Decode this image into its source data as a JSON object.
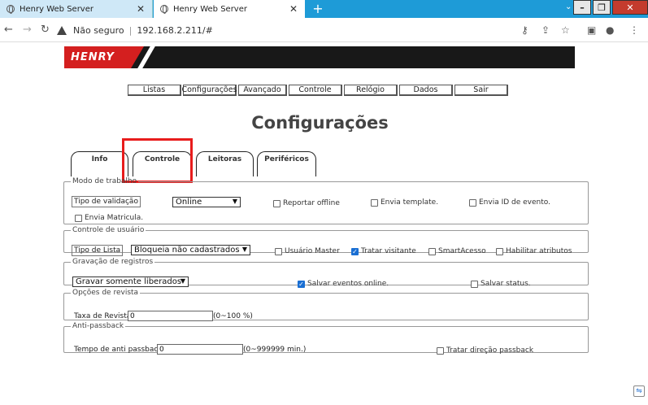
{
  "browser": {
    "tabs": [
      {
        "title": "Henry Web Server",
        "active": false
      },
      {
        "title": "Henry Web Server",
        "active": true
      }
    ],
    "new_tab": "+",
    "security_label": "Não seguro",
    "url": "192.168.2.211/#"
  },
  "banner": {
    "logo": "HENRY"
  },
  "menu": [
    "Listas",
    "Configurações",
    "Avançado",
    "Controle",
    "Relógio",
    "Dados",
    "Sair"
  ],
  "page_title": "Configurações",
  "tabs": [
    "Info",
    "Controle",
    "Leitoras",
    "Periféricos"
  ],
  "modo_trabalho": {
    "legend": "Modo de trabalho",
    "tipo_validacao_label": "Tipo de validação",
    "tipo_validacao_value": "Online",
    "reportar_offline": "Reportar offline",
    "envia_template": "Envia template.",
    "envia_id_evento": "Envia ID de evento.",
    "envia_matricula": "Envia Matricula."
  },
  "controle_usuario": {
    "legend": "Controle de usuário",
    "tipo_lista_label": "Tipo de Lista",
    "tipo_lista_value": "Bloqueia não cadastrados",
    "usuario_master": "Usuário Master",
    "tratar_visitante": "Tratar visitante",
    "smartacesso": "SmartAcesso",
    "habilitar_atributos": "Habilitar atributos"
  },
  "gravacao": {
    "legend": "Gravação de registros",
    "modo_value": "Gravar somente liberados",
    "salvar_eventos": "Salvar eventos online.",
    "salvar_status": "Salvar status."
  },
  "revista": {
    "legend": "Opções de revista",
    "taxa_label": "Taxa de Revista",
    "taxa_value": "0",
    "taxa_hint": "(0~100 %)"
  },
  "antipassback": {
    "legend": "Anti-passback",
    "tempo_label": "Tempo de anti passback",
    "tempo_value": "0",
    "tempo_hint": "(0~999999 min.)",
    "tratar_direcao": "Tratar direção passback"
  }
}
